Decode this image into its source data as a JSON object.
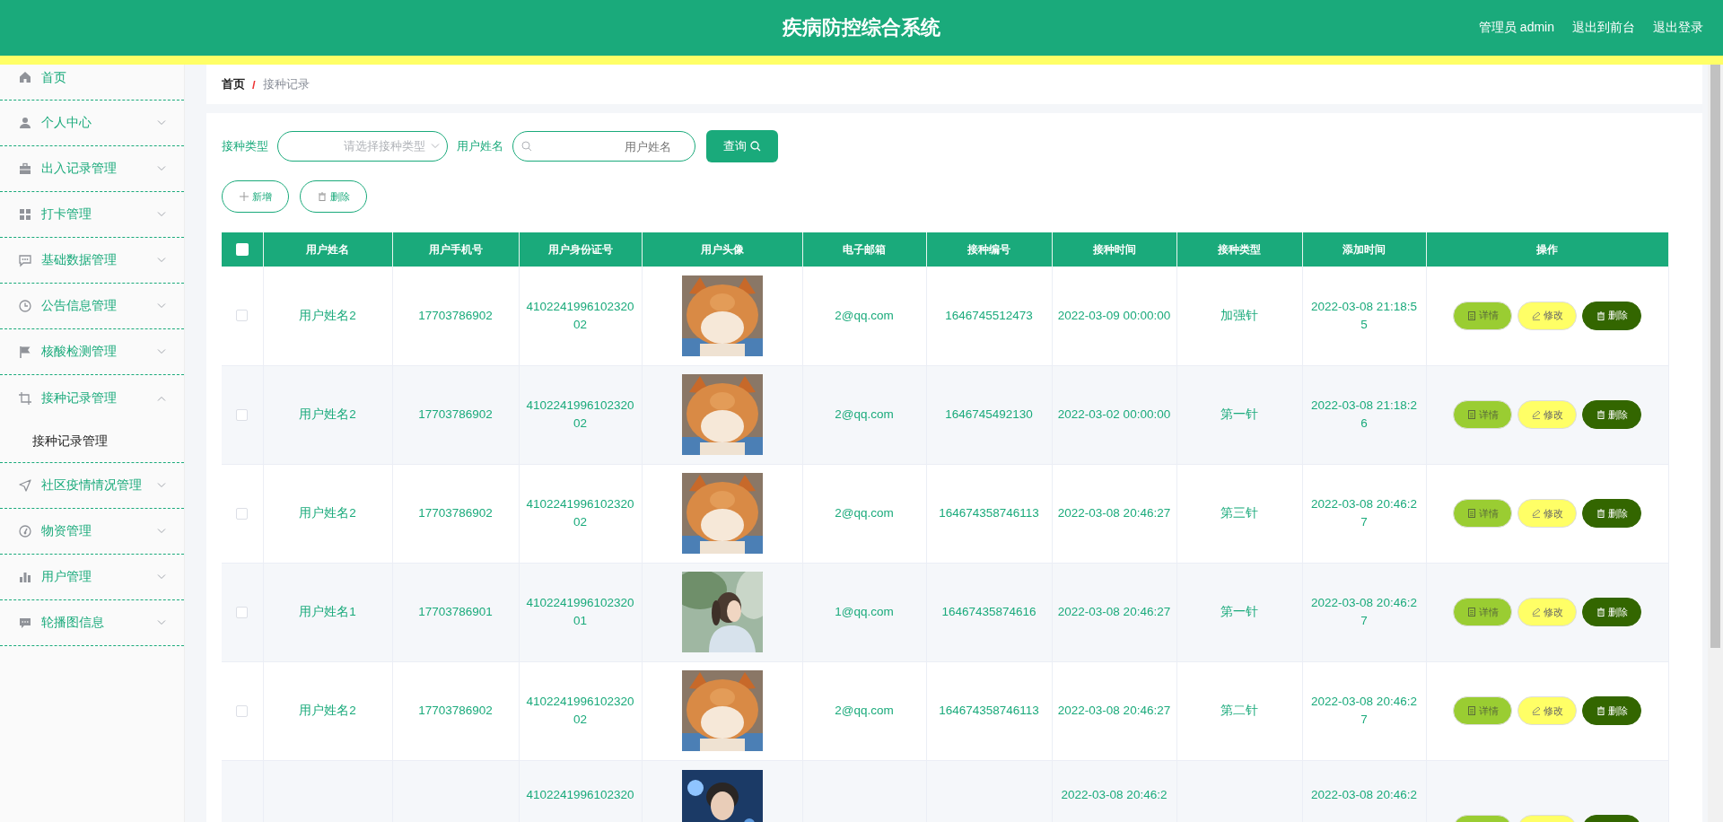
{
  "header": {
    "title": "疾病防控综合系统",
    "links": [
      "管理员 admin",
      "退出到前台",
      "退出登录"
    ]
  },
  "sidebar": {
    "items": [
      {
        "kind": "link",
        "label": "首页"
      },
      {
        "kind": "menu",
        "label": "个人中心",
        "expanded": false
      },
      {
        "kind": "menu",
        "label": "出入记录管理",
        "expanded": false
      },
      {
        "kind": "menu",
        "label": "打卡管理",
        "expanded": false
      },
      {
        "kind": "menu",
        "label": "基础数据管理",
        "expanded": false
      },
      {
        "kind": "menu",
        "label": "公告信息管理",
        "expanded": false
      },
      {
        "kind": "menu",
        "label": "核酸检测管理",
        "expanded": false
      },
      {
        "kind": "menu",
        "label": "接种记录管理",
        "expanded": true,
        "children": [
          {
            "label": "接种记录管理"
          }
        ]
      },
      {
        "kind": "menu",
        "label": "社区疫情情况管理",
        "expanded": false
      },
      {
        "kind": "menu",
        "label": "物资管理",
        "expanded": false
      },
      {
        "kind": "menu",
        "label": "用户管理",
        "expanded": false
      },
      {
        "kind": "menu",
        "label": "轮播图信息",
        "expanded": false
      }
    ]
  },
  "breadcrumb": {
    "home": "首页",
    "separator": "/",
    "current": "接种记录"
  },
  "filters": {
    "type_label": "接种类型",
    "type_placeholder": "请选择接种类型",
    "name_label": "用户姓名",
    "name_placeholder": "用户姓名",
    "query_button": "查询"
  },
  "toolbar": {
    "add": "新增",
    "delete": "删除"
  },
  "table": {
    "select_all_checked": false,
    "columns": [
      "用户姓名",
      "用户手机号",
      "用户身份证号",
      "用户头像",
      "电子邮箱",
      "接种编号",
      "接种时间",
      "接种类型",
      "添加时间",
      "操作"
    ],
    "rows": [
      {
        "checked": false,
        "cells": [
          "用户姓名2",
          "17703786902",
          "410224199610232002",
          null,
          "2@qq.com",
          "1646745512473",
          "2022-03-09 00:00:00",
          "加强针",
          "2022-03-08 21:18:55"
        ],
        "actions": [
          {
            "kind": "detail",
            "label": "详情"
          },
          {
            "kind": "edit",
            "label": "修改"
          },
          {
            "kind": "delete",
            "label": "删除"
          }
        ]
      },
      {
        "checked": false,
        "cells": [
          "用户姓名2",
          "17703786902",
          "410224199610232002",
          null,
          "2@qq.com",
          "1646745492130",
          "2022-03-02 00:00:00",
          "第一针",
          "2022-03-08 21:18:26"
        ],
        "actions": [
          {
            "kind": "detail",
            "label": "详情"
          },
          {
            "kind": "edit",
            "label": "修改"
          },
          {
            "kind": "delete",
            "label": "删除"
          }
        ]
      },
      {
        "checked": false,
        "cells": [
          "用户姓名2",
          "17703786902",
          "410224199610232002",
          null,
          "2@qq.com",
          "164674358746113",
          "2022-03-08 20:46:27",
          "第三针",
          "2022-03-08 20:46:27"
        ],
        "actions": [
          {
            "kind": "detail",
            "label": "详情"
          },
          {
            "kind": "edit",
            "label": "修改"
          },
          {
            "kind": "delete",
            "label": "删除"
          }
        ]
      },
      {
        "checked": false,
        "cells": [
          "用户姓名1",
          "17703786901",
          "410224199610232001",
          null,
          "1@qq.com",
          "16467435874616",
          "2022-03-08 20:46:27",
          "第一针",
          "2022-03-08 20:46:27"
        ],
        "actions": [
          {
            "kind": "detail",
            "label": "详情"
          },
          {
            "kind": "edit",
            "label": "修改"
          },
          {
            "kind": "delete",
            "label": "删除"
          }
        ]
      },
      {
        "checked": false,
        "cells": [
          "用户姓名2",
          "17703786902",
          "410224199610232002",
          null,
          "2@qq.com",
          "164674358746113",
          "2022-03-08 20:46:27",
          "第二针",
          "2022-03-08 20:46:27"
        ],
        "actions": [
          {
            "kind": "detail",
            "label": "详情"
          },
          {
            "kind": "edit",
            "label": "修改"
          },
          {
            "kind": "delete",
            "label": "删除"
          }
        ]
      },
      {
        "partial": true,
        "cells": [
          null,
          null,
          "4102241996102320",
          null,
          null,
          null,
          "2022-03-08 20:46:2",
          null,
          "2022-03-08 20:46:2"
        ],
        "actions": [
          {
            "kind": "detail"
          },
          {
            "kind": "edit"
          },
          {
            "kind": "delete"
          }
        ]
      }
    ]
  }
}
